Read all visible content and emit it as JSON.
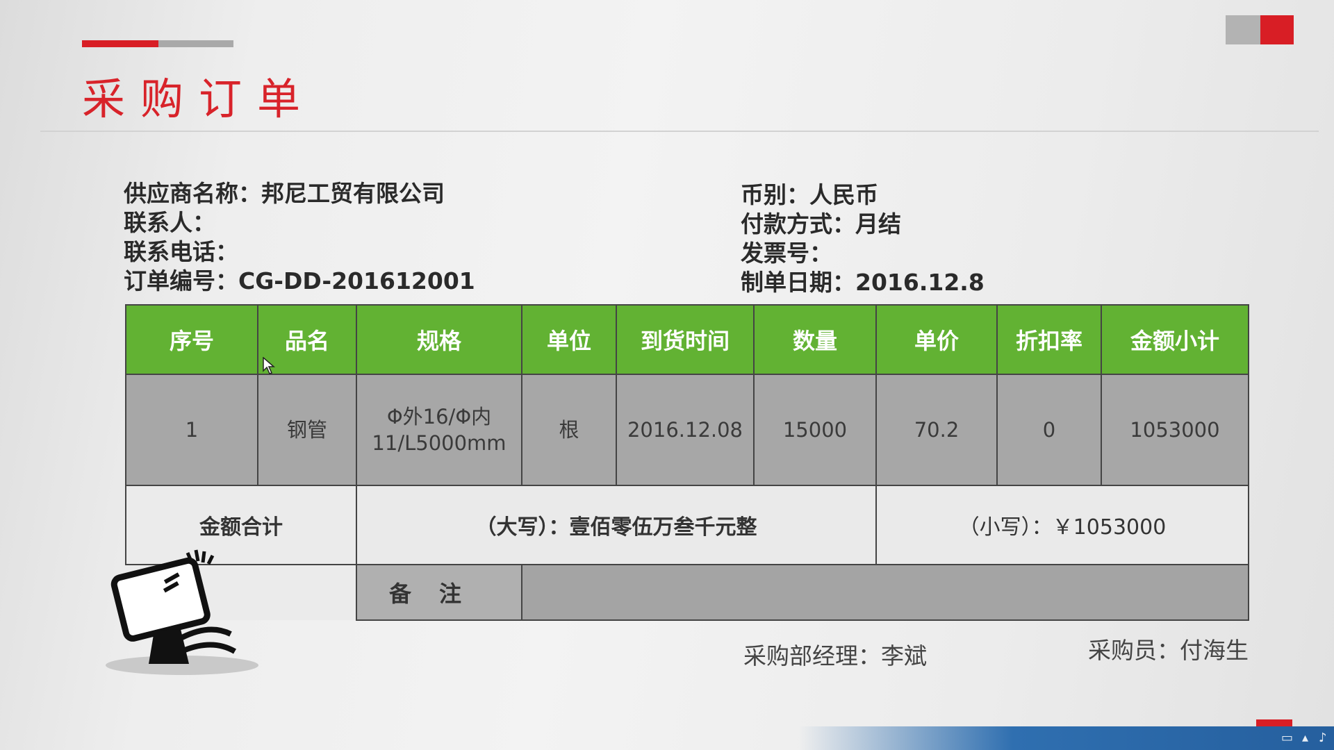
{
  "header": {
    "title": "采购订单"
  },
  "info": {
    "supplier": "供应商名称：邦尼工贸有限公司",
    "contact": "联系人：",
    "phone": "联系电话：",
    "order_no": "订单编号：CG-DD-201612001",
    "currency": "币别：人民币",
    "payment": "付款方式：月结",
    "invoice": "发票号：",
    "date": "制单日期：2016.12.8"
  },
  "table": {
    "headers": [
      "序号",
      "品名",
      "规格",
      "单位",
      "到货时间",
      "数量",
      "单价",
      "折扣率",
      "金额小计"
    ],
    "rows": [
      [
        "1",
        "钢管",
        "Φ外16/Φ内\n11/L5000mm",
        "根",
        "2016.12.08",
        "15000",
        "70.2",
        "0",
        "1053000"
      ]
    ],
    "total_label": "金额合计",
    "total_upper": "（大写）：壹佰零伍万叁千元整",
    "total_lower": "（小写）：￥1053000",
    "remark_label": "备注"
  },
  "signers": {
    "manager": "采购部经理：李斌",
    "buyer": "采购员：付海生"
  },
  "colors": {
    "accent_red": "#d81e25",
    "header_green": "#62b233",
    "row_gray": "#a7a7a7"
  }
}
